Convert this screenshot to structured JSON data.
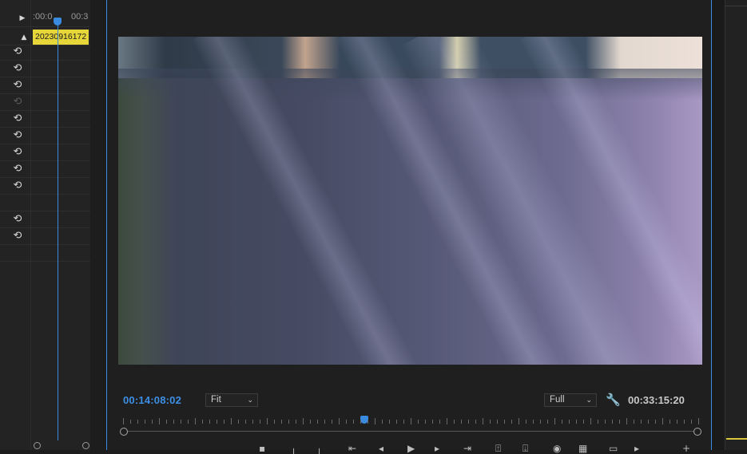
{
  "effects_timeline": {
    "ruler_labels": [
      ":00:0",
      "00:3"
    ],
    "clip_name": "20230916172",
    "rows": [
      {
        "icon": "play-triangle-icon"
      },
      {
        "icon": "collapse-triangle-icon"
      },
      {
        "icon": "reset-icon",
        "enabled": true
      },
      {
        "icon": "reset-icon",
        "enabled": true
      },
      {
        "icon": "reset-icon",
        "enabled": true
      },
      {
        "icon": "reset-icon",
        "enabled": false
      },
      {
        "icon": "reset-icon",
        "enabled": true
      },
      {
        "icon": "reset-icon",
        "enabled": true
      },
      {
        "icon": "reset-icon",
        "enabled": true
      },
      {
        "icon": "reset-icon",
        "enabled": true
      },
      {
        "icon": "reset-icon",
        "enabled": true
      },
      {
        "icon": "reset-icon",
        "enabled": true
      },
      {
        "icon": "reset-icon",
        "enabled": true
      }
    ]
  },
  "program_monitor": {
    "current_timecode": "00:14:08:02",
    "duration_timecode": "00:33:15:20",
    "zoom_dropdown": {
      "selected": "Fit"
    },
    "resolution_dropdown": {
      "selected": "Full"
    },
    "playhead_position_fraction": 0.42,
    "accent_color": "#3a8be0"
  }
}
